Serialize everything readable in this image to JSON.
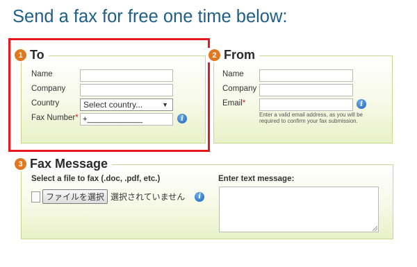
{
  "headline": "Send a fax for free one time below:",
  "to": {
    "step": "1",
    "title": "To",
    "name_label": "Name",
    "name_value": "",
    "company_label": "Company",
    "company_value": "",
    "country_label": "Country",
    "country_selected": "Select country...",
    "fax_label": "Fax Number",
    "fax_required": "*",
    "fax_value": "+_____________"
  },
  "from": {
    "step": "2",
    "title": "From",
    "name_label": "Name",
    "name_value": "",
    "company_label": "Company",
    "company_value": "",
    "email_label": "Email",
    "email_required": "*",
    "email_value": "",
    "email_hint": "Enter a valid email address, as you will be required to confirm your fax submission."
  },
  "fax_message": {
    "step": "3",
    "title": "Fax Message",
    "file_label": "Select a file to fax (.doc, .pdf, etc.)",
    "file_button": "ファイルを選択",
    "file_status": "選択されていません",
    "text_label": "Enter text message:",
    "text_value": ""
  },
  "icons": {
    "info": "info-icon",
    "dropdown": "chevron-down-icon",
    "file": "file-icon"
  },
  "colors": {
    "headline": "#1f5f86",
    "step_badge": "#e07820",
    "highlight_box": "#e8181f",
    "panel_border": "#c9d88f"
  }
}
